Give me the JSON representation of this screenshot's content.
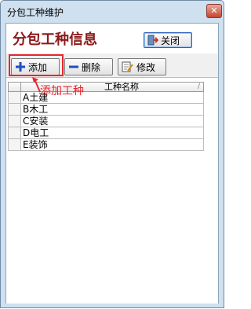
{
  "window": {
    "title": "分包工种维护",
    "close_glyph": "✕"
  },
  "header": {
    "title": "分包工种信息",
    "close_button_label": "关闭"
  },
  "toolbar": {
    "add_label": "添加",
    "delete_label": "删除",
    "edit_label": "修改"
  },
  "grid": {
    "column_header": "工种名称",
    "sort_glyph": "/",
    "rows": [
      "A土建",
      "B木工",
      "C安装",
      "D电工",
      "E装饰"
    ]
  },
  "annotation": {
    "text": "添加工种"
  },
  "colors": {
    "highlight": "#e8262c",
    "title": "#8b1a1a"
  }
}
